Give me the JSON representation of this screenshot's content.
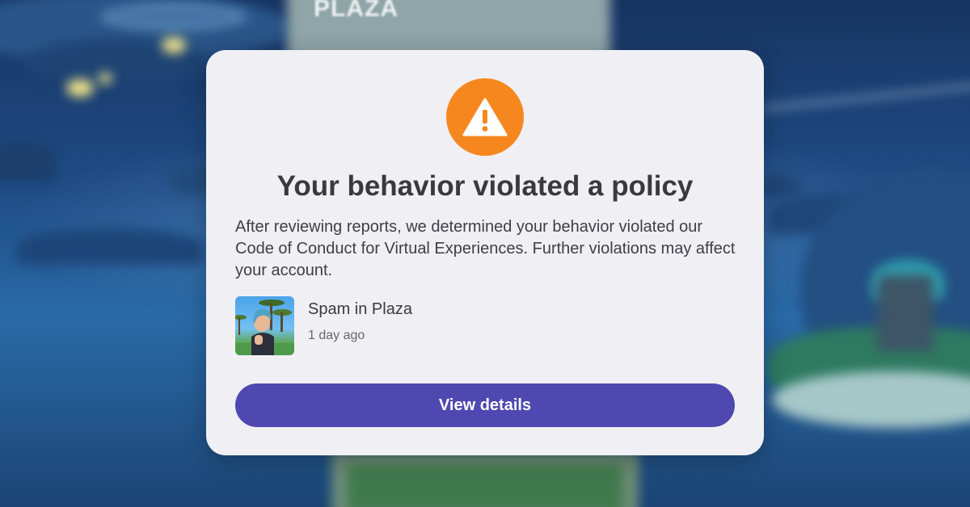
{
  "background": {
    "sign_text": "PLAZA"
  },
  "dialog": {
    "icon": "warning-icon",
    "title": "Your behavior violated a policy",
    "description": "After reviewing reports, we determined your behavior violated our Code of Conduct for Virtual Experiences. Further violations may affect your account.",
    "report": {
      "name": "Spam in Plaza",
      "time": "1 day ago"
    },
    "button_label": "View details"
  },
  "colors": {
    "warning": "#f6871f",
    "button": "#4f48b0",
    "dialog_bg": "#f0f0f4",
    "title_text": "#3a3a3e"
  }
}
